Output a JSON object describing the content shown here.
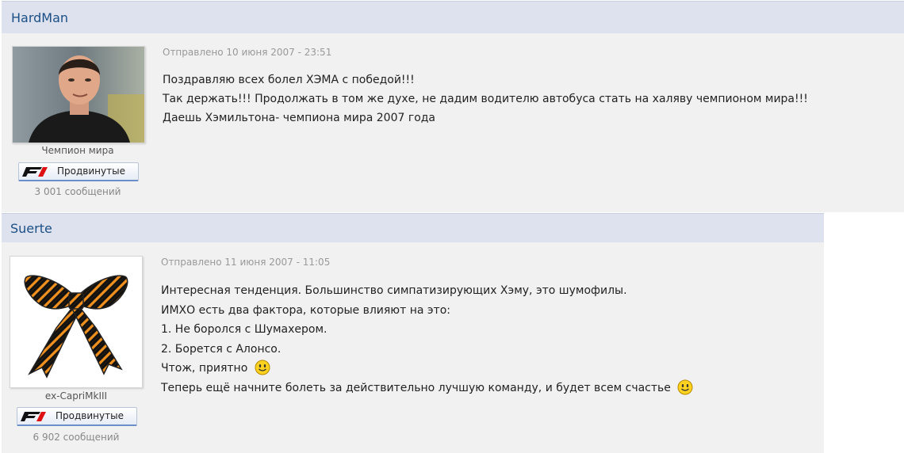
{
  "posts": [
    {
      "author": "HardMan",
      "date": "Отправлено 10 июня 2007 - 23:51",
      "user_title": "Чемпион мира",
      "group": "Продвинутые",
      "post_count": "3 001 сообщений",
      "lines": [
        "Поздравляю всех болел ХЭМА с победой!!!",
        "Так держать!!! Продолжать в том же духе, не дадим водителю автобуса стать на халяву чемпионом мира!!!",
        "Даешь Хэмильтона- чемпиона мира 2007 года"
      ]
    },
    {
      "author": "Suerte",
      "date": "Отправлено 11 июня 2007 - 11:05",
      "user_title": "ex-CapriMkIII",
      "group": "Продвинутые",
      "post_count": "6 902 сообщений",
      "lines": [
        "Интересная тенденция. Большинство симпатизирующих Хэму, это шумофилы.",
        "ИМХО есть два фактора, которые влияют на это:",
        "1. Не боролся с Шумахером.",
        "2. Борется с Алонсо.",
        "Чтож, приятно",
        "Теперь ещё начните болеть за действительно лучшую команду, и будет всем счастье"
      ]
    }
  ],
  "colors": {
    "header_bg": "#dde2ee",
    "post_bg": "#f1f1f1",
    "author_link": "#1c4f86",
    "ribbon_orange": "#f0901e"
  },
  "icons": {
    "group_logo": "f1-logo-icon",
    "emoticon": "smiley-icon"
  }
}
